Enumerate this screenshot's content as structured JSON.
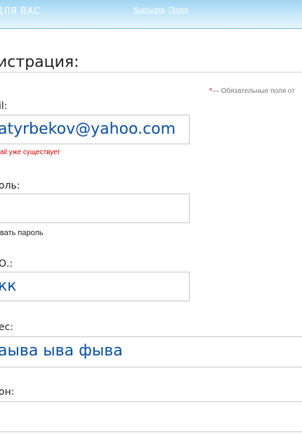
{
  "header": {
    "brand": "ДЛЯ ВАС",
    "links": [
      "Кыргызча",
      "Поиск"
    ]
  },
  "page": {
    "title": "истрация:",
    "required_star": "*",
    "required_note": "— Обязательные поля от"
  },
  "form": {
    "email": {
      "label": "il:",
      "value": "atyrbekov@yahoo.com",
      "error": "ail уже существует"
    },
    "password": {
      "label": "оль:",
      "value": "",
      "show_label": "вать пароль"
    },
    "fio": {
      "label": "О.:",
      "value": "кк"
    },
    "address": {
      "label": "ес:",
      "value": "аыва ыва фыва"
    },
    "phone": {
      "label": "он:",
      "value": ""
    }
  },
  "colors": {
    "accent": "#0a4fa3",
    "error": "#cc0000",
    "header_top": "#9fd5f3",
    "header_bottom": "#e6f5fd"
  }
}
